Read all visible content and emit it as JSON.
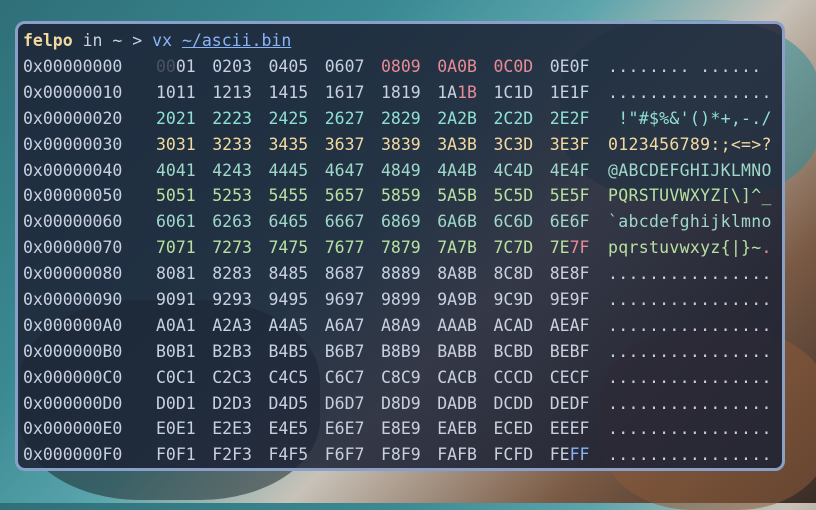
{
  "prompt": {
    "user": "felpo",
    "in": "in",
    "dir": "~",
    "arrow": ">",
    "cmd": "vx",
    "arg": "~/ascii.bin"
  },
  "colors": {
    "null": "#4a5268",
    "control": "#e88a96",
    "punct": "#8fe0d0",
    "digit": "#f2d9a0",
    "upper": "#b8e0a0",
    "lower": "#b8e0a0",
    "high": "#c8d0e0",
    "dots": "#c8d0e0",
    "del": "#e88a96",
    "ff": "#8ab4f8"
  },
  "rows": [
    {
      "addr": "0x00000000",
      "hex": [
        "0001",
        "0203",
        "0405",
        "0607",
        "0809",
        "0A0B",
        "0C0D",
        "0E0F"
      ],
      "ascii": "........ ......"
    },
    {
      "addr": "0x00000010",
      "hex": [
        "1011",
        "1213",
        "1415",
        "1617",
        "1819",
        "1A1B",
        "1C1D",
        "1E1F"
      ],
      "ascii": "................"
    },
    {
      "addr": "0x00000020",
      "hex": [
        "2021",
        "2223",
        "2425",
        "2627",
        "2829",
        "2A2B",
        "2C2D",
        "2E2F"
      ],
      "ascii": " !\"#$%&'()*+,-./"
    },
    {
      "addr": "0x00000030",
      "hex": [
        "3031",
        "3233",
        "3435",
        "3637",
        "3839",
        "3A3B",
        "3C3D",
        "3E3F"
      ],
      "ascii": "0123456789:;<=>?"
    },
    {
      "addr": "0x00000040",
      "hex": [
        "4041",
        "4243",
        "4445",
        "4647",
        "4849",
        "4A4B",
        "4C4D",
        "4E4F"
      ],
      "ascii": "@ABCDEFGHIJKLMNO"
    },
    {
      "addr": "0x00000050",
      "hex": [
        "5051",
        "5253",
        "5455",
        "5657",
        "5859",
        "5A5B",
        "5C5D",
        "5E5F"
      ],
      "ascii": "PQRSTUVWXYZ[\\]^_"
    },
    {
      "addr": "0x00000060",
      "hex": [
        "6061",
        "6263",
        "6465",
        "6667",
        "6869",
        "6A6B",
        "6C6D",
        "6E6F"
      ],
      "ascii": "`abcdefghijklmno"
    },
    {
      "addr": "0x00000070",
      "hex": [
        "7071",
        "7273",
        "7475",
        "7677",
        "7879",
        "7A7B",
        "7C7D",
        "7E7F"
      ],
      "ascii": "pqrstuvwxyz{|}~."
    },
    {
      "addr": "0x00000080",
      "hex": [
        "8081",
        "8283",
        "8485",
        "8687",
        "8889",
        "8A8B",
        "8C8D",
        "8E8F"
      ],
      "ascii": "................"
    },
    {
      "addr": "0x00000090",
      "hex": [
        "9091",
        "9293",
        "9495",
        "9697",
        "9899",
        "9A9B",
        "9C9D",
        "9E9F"
      ],
      "ascii": "................"
    },
    {
      "addr": "0x000000A0",
      "hex": [
        "A0A1",
        "A2A3",
        "A4A5",
        "A6A7",
        "A8A9",
        "AAAB",
        "ACAD",
        "AEAF"
      ],
      "ascii": "................"
    },
    {
      "addr": "0x000000B0",
      "hex": [
        "B0B1",
        "B2B3",
        "B4B5",
        "B6B7",
        "B8B9",
        "BABB",
        "BCBD",
        "BEBF"
      ],
      "ascii": "................"
    },
    {
      "addr": "0x000000C0",
      "hex": [
        "C0C1",
        "C2C3",
        "C4C5",
        "C6C7",
        "C8C9",
        "CACB",
        "CCCD",
        "CECF"
      ],
      "ascii": "................"
    },
    {
      "addr": "0x000000D0",
      "hex": [
        "D0D1",
        "D2D3",
        "D4D5",
        "D6D7",
        "D8D9",
        "DADB",
        "DCDD",
        "DEDF"
      ],
      "ascii": "................"
    },
    {
      "addr": "0x000000E0",
      "hex": [
        "E0E1",
        "E2E3",
        "E4E5",
        "E6E7",
        "E8E9",
        "EAEB",
        "ECED",
        "EEEF"
      ],
      "ascii": "................"
    },
    {
      "addr": "0x000000F0",
      "hex": [
        "F0F1",
        "F2F3",
        "F4F5",
        "F6F7",
        "F8F9",
        "FAFB",
        "FCFD",
        "FEFF"
      ],
      "ascii": "................"
    }
  ]
}
